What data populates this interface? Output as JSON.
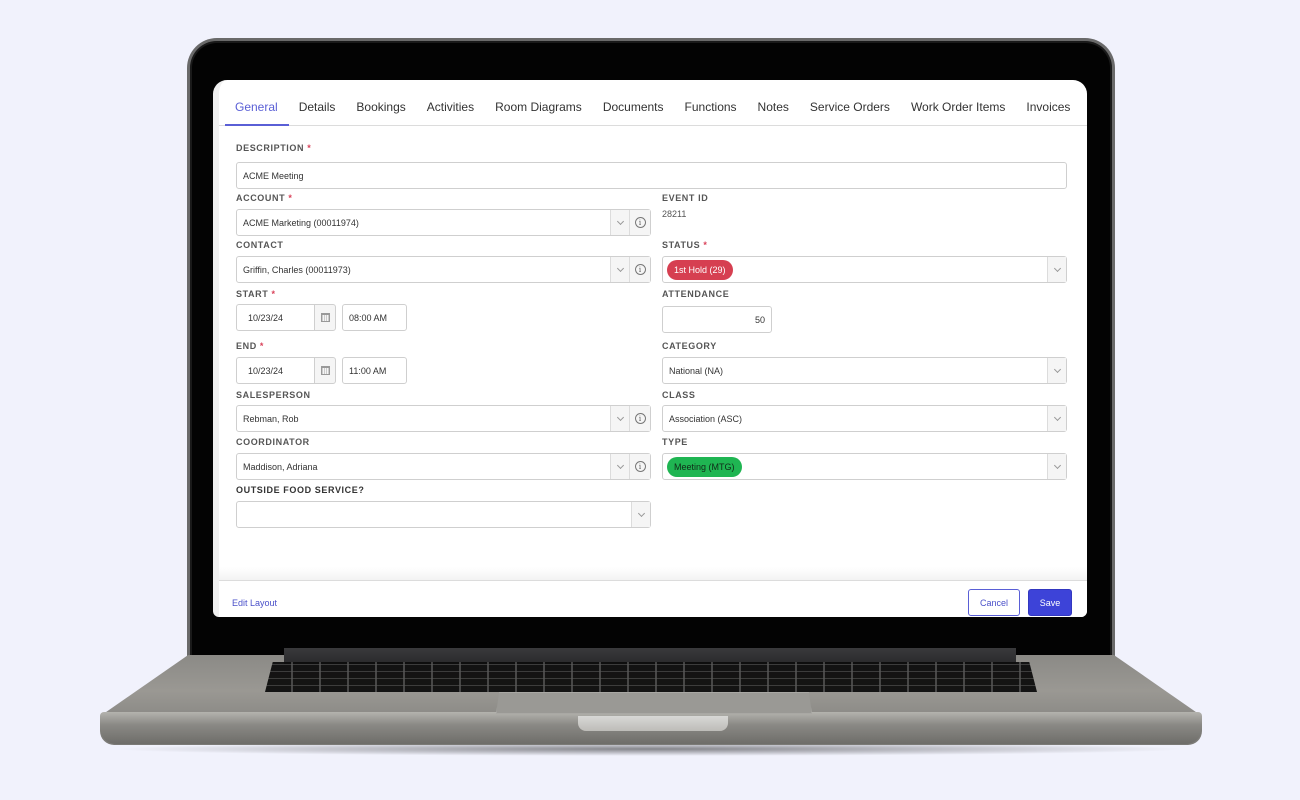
{
  "tabs": [
    {
      "label": "General",
      "active": true
    },
    {
      "label": "Details"
    },
    {
      "label": "Bookings"
    },
    {
      "label": "Activities"
    },
    {
      "label": "Room Diagrams"
    },
    {
      "label": "Documents"
    },
    {
      "label": "Functions"
    },
    {
      "label": "Notes"
    },
    {
      "label": "Service Orders"
    },
    {
      "label": "Work Order Items"
    },
    {
      "label": "Invoices"
    }
  ],
  "form": {
    "required_marker": "*",
    "description": {
      "label": "DESCRIPTION",
      "value": "ACME Meeting"
    },
    "account": {
      "label": "ACCOUNT",
      "value": "ACME Marketing (00011974)"
    },
    "event_id": {
      "label": "EVENT ID",
      "value": "28211"
    },
    "contact": {
      "label": "CONTACT",
      "value": "Griffin, Charles (00011973)"
    },
    "status": {
      "label": "STATUS",
      "value": "1st Hold (29)",
      "color": "#d63f51"
    },
    "start": {
      "label": "START",
      "date": "10/23/24",
      "time": "08:00 AM"
    },
    "attendance": {
      "label": "ATTENDANCE",
      "value": "50"
    },
    "end": {
      "label": "END",
      "date": "10/23/24",
      "time": "11:00 AM"
    },
    "category": {
      "label": "CATEGORY",
      "value": "National (NA)"
    },
    "salesperson": {
      "label": "SALESPERSON",
      "value": "Rebman, Rob"
    },
    "class": {
      "label": "CLASS",
      "value": "Association (ASC)"
    },
    "coordinator": {
      "label": "COORDINATOR",
      "value": "Maddison, Adriana"
    },
    "type": {
      "label": "TYPE",
      "value": "Meeting (MTG)",
      "color": "#1fb552"
    },
    "outside_food": {
      "label": "OUTSIDE FOOD SERVICE?",
      "value": ""
    }
  },
  "footer": {
    "edit_layout": "Edit Layout",
    "cancel": "Cancel",
    "save": "Save"
  },
  "icons": {
    "info": "i"
  },
  "colors": {
    "accent": "#5a5fd6",
    "save_bg": "#3d43d8",
    "page_bg": "#f1f2fc"
  }
}
